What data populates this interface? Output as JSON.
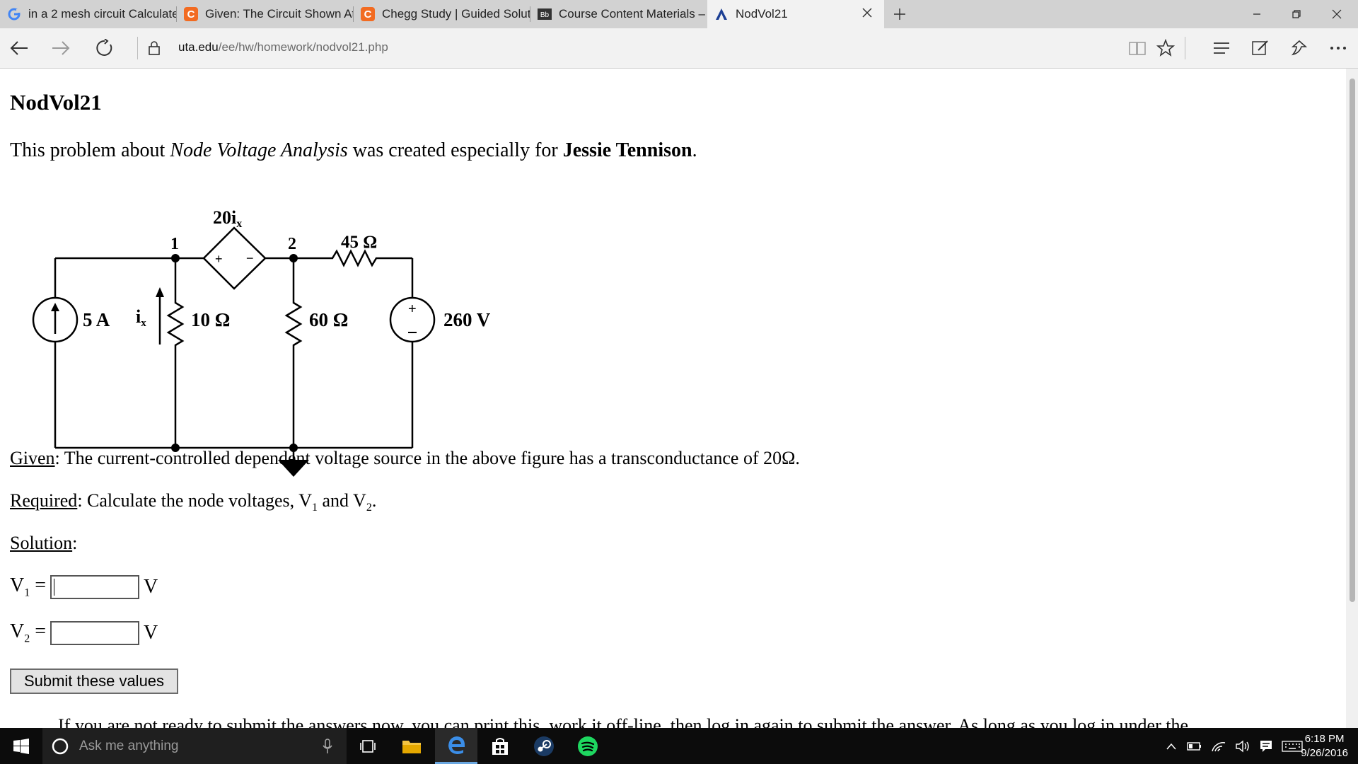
{
  "browser": {
    "tabs": [
      {
        "title": "in a 2 mesh circuit Calculate",
        "favicon": "google-icon"
      },
      {
        "title": "Given: The Circuit Shown At",
        "favicon": "chegg-icon"
      },
      {
        "title": "Chegg Study | Guided Solut",
        "favicon": "chegg-icon"
      },
      {
        "title": "Course Content Materials –",
        "favicon": "blackboard-icon",
        "favicon_text": "Bb"
      },
      {
        "title": "NodVol21",
        "favicon": "uta-icon",
        "active": true
      }
    ],
    "url_domain": "uta.edu",
    "url_path": "/ee/hw/homework/nodvol21.php"
  },
  "page": {
    "title": "NodVol21",
    "intro": {
      "prefix": "This problem about ",
      "topic": "Node Voltage Analysis",
      "middle": " was created especially for ",
      "student": "Jessie Tennison",
      "suffix": "."
    },
    "circuit": {
      "dep_source_label": "20i",
      "dep_source_sub": "x",
      "node1": "1",
      "node2": "2",
      "r_series": "45 Ω",
      "current_source": "5 A",
      "ix_label": "i",
      "ix_sub": "x",
      "r1": "10 Ω",
      "r2": "60 Ω",
      "voltage_source": "260 V",
      "plus": "+",
      "minus": "−"
    },
    "given": {
      "label": "Given",
      "text": ": The current-controlled dependent voltage source in the above figure has a transconductance of 20Ω."
    },
    "required": {
      "label": "Required",
      "text_a": ": Calculate the node voltages, V",
      "sub1": "1",
      "text_b": " and V",
      "sub2": "2",
      "text_c": "."
    },
    "solution": {
      "label": "Solution",
      "colon": ":"
    },
    "inputs": [
      {
        "var": "V",
        "sub": "1",
        "eq": " =",
        "value": "",
        "unit": "V"
      },
      {
        "var": "V",
        "sub": "2",
        "eq": " =",
        "value": "",
        "unit": "V"
      }
    ],
    "submit_label": "Submit these values",
    "note": "If you are not ready to submit the answers now, you can print this, work it off-line, then log in again to submit the answer. As long as you log in under the"
  },
  "taskbar": {
    "search_placeholder": "Ask me anything",
    "time": "6:18 PM",
    "date": "9/26/2016"
  }
}
